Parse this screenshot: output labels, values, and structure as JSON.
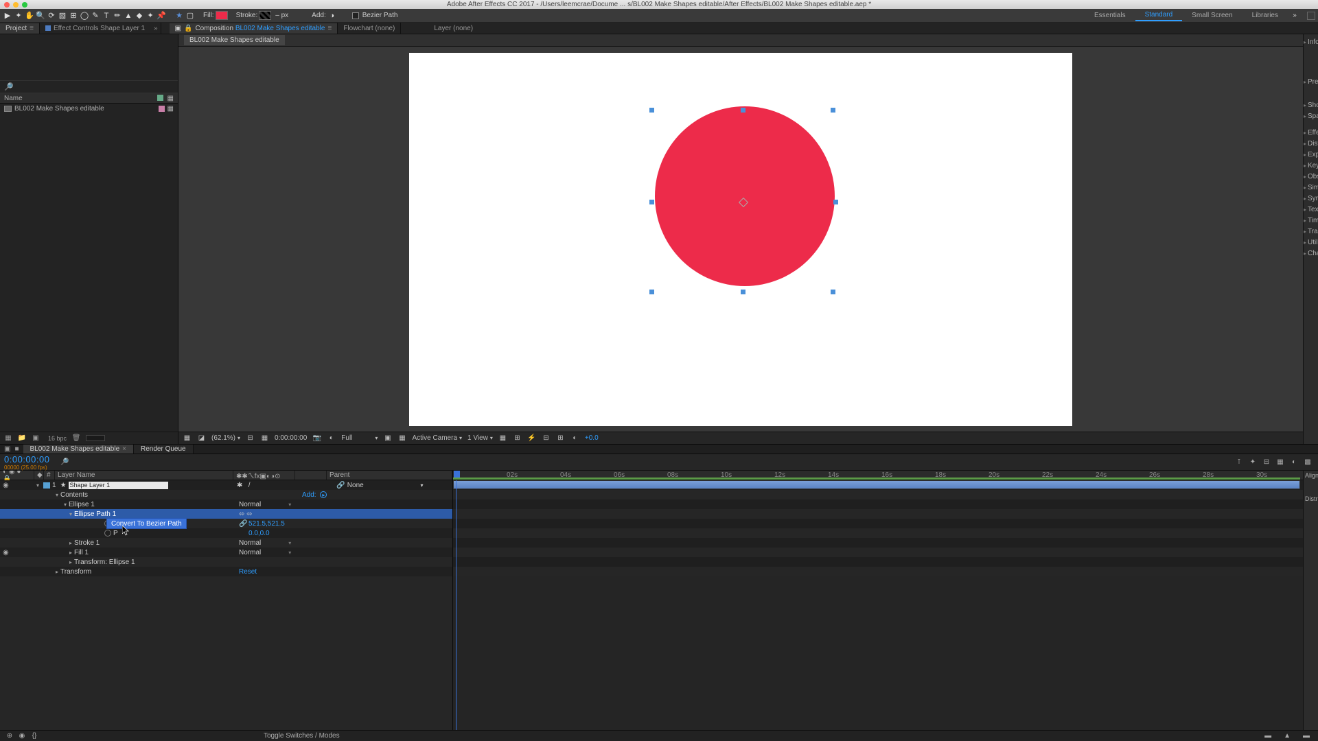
{
  "mac": {
    "title": "Adobe After Effects CC 2017 - /Users/leemcrae/Docume ... s/BL002 Make Shapes editable/After Effects/BL002 Make Shapes editable.aep *"
  },
  "toolbar": {
    "snap_label": "",
    "fill_label": "Fill:",
    "stroke_label": "Stroke:",
    "stroke_value": "– px",
    "add_label": "Add:",
    "bezier_label": "Bezier Path",
    "fill_color": "#ed2b4a"
  },
  "workspaces": [
    "Essentials",
    "Standard",
    "Small Screen",
    "Libraries"
  ],
  "active_workspace": "Standard",
  "panels": {
    "project_tab": "Project",
    "effect_controls_tab": "Effect Controls Shape Layer 1",
    "composition_tab_prefix": "Composition",
    "composition_name": "BL002 Make Shapes editable",
    "flowchart_tab": "Flowchart (none)",
    "layer_tab": "Layer (none)",
    "nested_tab": "BL002 Make Shapes editable"
  },
  "right_dock": [
    "Info",
    "Preview",
    "Shortcuts",
    "Space",
    "Effects",
    "Character"
  ],
  "right_dock_rows": [
    "Distort",
    "Expression",
    "Keying",
    "Obsolete",
    "Simulation",
    "Synthetic",
    "Text",
    "Time",
    "Transition",
    "Utility"
  ],
  "project": {
    "col_name": "Name",
    "item": "BL002 Make Shapes editable",
    "bpc": "16 bpc"
  },
  "viewer": {
    "zoom": "(62.1%)",
    "timecode": "0:00:00:00",
    "resolution": "Full",
    "camera": "Active Camera",
    "views": "1 View",
    "exposure": "+0.0",
    "shape_fill": "#ed2b4a",
    "handle_color": "#4a90d9"
  },
  "timeline_tabs": {
    "comp_tab": "BL002 Make Shapes editable",
    "render_queue": "Render Queue"
  },
  "timeline": {
    "timecode": "0:00:00:00",
    "sub_timecode": "00000 (25.00 fps)",
    "col_layer_name": "Layer Name",
    "col_parent": "Parent",
    "layer_name": "Shape Layer 1",
    "layer_num": "1",
    "mode_normal": "Normal",
    "parent_none": "None",
    "add_label": "Add:",
    "reset_label": "Reset",
    "contents_label": "Contents",
    "ellipse1_label": "Ellipse 1",
    "ellipse_path_label": "Ellipse Path 1",
    "size_label": "S",
    "pos_label": "P",
    "size_value": "521.5,521.5",
    "pos_value": "0.0,0.0",
    "stroke1_label": "Stroke 1",
    "fill1_label": "Fill 1",
    "transform_ellipse_label": "Transform: Ellipse 1",
    "transform_label": "Transform",
    "context_menu": "Convert To Bezier Path",
    "toggle_switches": "Toggle Switches / Modes",
    "ticks": [
      "02s",
      "04s",
      "06s",
      "08s",
      "10s",
      "12s",
      "14s",
      "16s",
      "18s",
      "20s",
      "22s",
      "24s",
      "26s",
      "28s",
      "30s"
    ],
    "ruler_start": "0"
  }
}
